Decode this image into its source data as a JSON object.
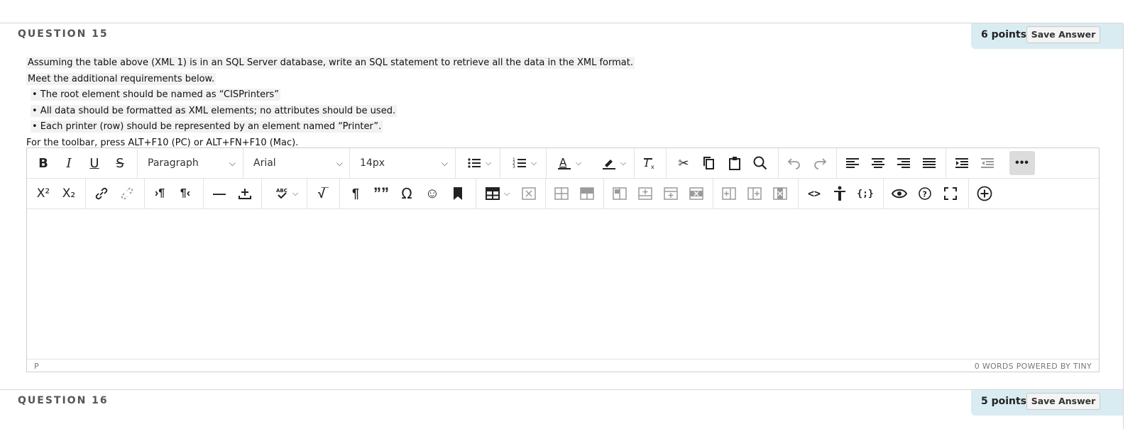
{
  "q15": {
    "title": "QUESTION 15",
    "points": "6 points",
    "save_label": "Save Answer",
    "lines": [
      "Assuming the table above (XML 1) is in an SQL Server database, write an SQL statement to retrieve all the data in the XML format.",
      "Meet the additional requirements below.",
      "• The root element should be named as “CISPrinters”",
      "• All data should be formatted as XML elements; no attributes should be used.",
      "• Each printer (row) should be represented by an element named “Printer”.",
      "For the toolbar, press ALT+F10 (PC) or ALT+FN+F10 (Mac)."
    ]
  },
  "editor": {
    "block_format": "Paragraph",
    "font_family": "Arial",
    "font_size": "14px",
    "status_path": "P",
    "status_words": "0 WORDS  POWERED BY TINY",
    "glyphs": {
      "bold": "B",
      "italic": "I",
      "underline": "U",
      "strike": "S",
      "superscript": "X²",
      "subscript": "X₂",
      "paragraph_mark": "¶",
      "blockquote": "””",
      "omega": "Ω",
      "emoji": "☺",
      "code": "<>",
      "template": "{;}"
    }
  },
  "q16": {
    "title": "QUESTION 16",
    "points": "5 points",
    "save_label": "Save Answer"
  },
  "colors": {
    "points_bg": "#d9ecf2",
    "text_dark": "#222222",
    "muted_icon": "#9a9a9a"
  }
}
